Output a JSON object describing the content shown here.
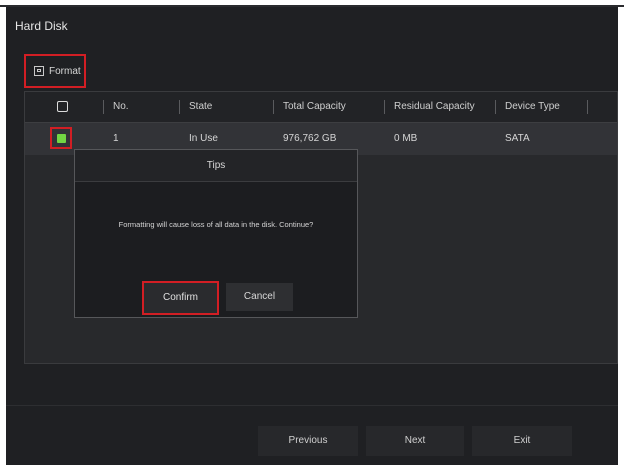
{
  "window": {
    "title": "Hard Disk"
  },
  "toolbar": {
    "format_label": "Format",
    "format_icon": "format-disk-icon"
  },
  "table": {
    "headers": [
      "No.",
      "State",
      "Total Capacity",
      "Residual Capacity",
      "Device Type"
    ],
    "rows": [
      {
        "checked": true,
        "no": "1",
        "state": "In Use",
        "total_capacity": "976,762 GB",
        "residual_capacity": "0 MB",
        "device_type": "SATA"
      }
    ]
  },
  "dialog": {
    "title": "Tips",
    "message": "Formatting will cause loss of all data in the disk. Continue?",
    "confirm_label": "Confirm",
    "cancel_label": "Cancel"
  },
  "footer": {
    "previous_label": "Previous",
    "next_label": "Next",
    "exit_label": "Exit"
  },
  "colors": {
    "highlight": "#d21e24",
    "checkbox_checked": "#73d643",
    "background": "#1f2023"
  }
}
